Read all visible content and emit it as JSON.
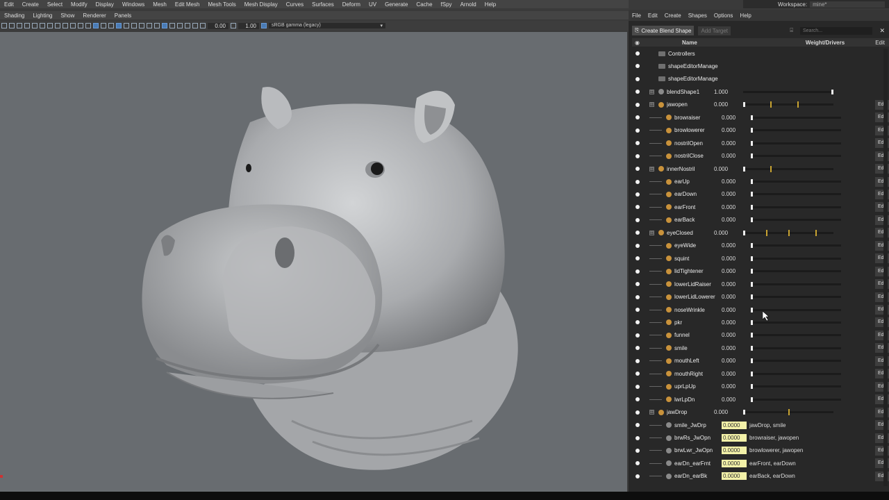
{
  "main_menu": [
    "Edit",
    "Create",
    "Select",
    "Modify",
    "Display",
    "Windows",
    "Mesh",
    "Edit Mesh",
    "Mesh Tools",
    "Mesh Display",
    "Curves",
    "Surfaces",
    "Deform",
    "UV",
    "Generate",
    "Cache",
    "fSpy",
    "Arnold",
    "Help"
  ],
  "workspace": {
    "label": "Workspace:",
    "value": "mine*"
  },
  "panel_menu": [
    "Shading",
    "Lighting",
    "Show",
    "Renderer",
    "Panels"
  ],
  "viewport_toolbar": {
    "value1": "0.00",
    "value2": "1.00",
    "color_space": "sRGB gamma (legacy)"
  },
  "shape_editor": {
    "menu": [
      "File",
      "Edit",
      "Create",
      "Shapes",
      "Options",
      "Help"
    ],
    "create_blend_shape": "Create Blend Shape",
    "add_target": "Add Target",
    "search_placeholder": "Search...",
    "col_name": "Name",
    "col_weight": "Weight/Drivers",
    "col_edit": "Edit",
    "rows": [
      {
        "name": "Controllers",
        "kind": "folder"
      },
      {
        "name": "shapeEditorManage",
        "kind": "folder"
      },
      {
        "name": "shapeEditorManage",
        "kind": "folder"
      },
      {
        "name": "blendShape1",
        "kind": "blend",
        "weight": "1.000",
        "knob": 1.0
      },
      {
        "name": "jawopen",
        "kind": "target",
        "weight": "0.000",
        "keys": [
          0.3,
          0.6
        ],
        "expand": true
      },
      {
        "name": "browraiser",
        "kind": "target",
        "weight": "0.000"
      },
      {
        "name": "browlowerer",
        "kind": "target",
        "weight": "0.000"
      },
      {
        "name": "nostrilOpen",
        "kind": "target",
        "weight": "0.000"
      },
      {
        "name": "nostrilClose",
        "kind": "target",
        "weight": "0.000"
      },
      {
        "name": "innerNostril",
        "kind": "target",
        "weight": "0.000",
        "keys": [
          0.3
        ],
        "expand": true
      },
      {
        "name": "earUp",
        "kind": "target",
        "weight": "0.000"
      },
      {
        "name": "earDown",
        "kind": "target",
        "weight": "0.000"
      },
      {
        "name": "earFront",
        "kind": "target",
        "weight": "0.000"
      },
      {
        "name": "earBack",
        "kind": "target",
        "weight": "0.000"
      },
      {
        "name": "eyeClosed",
        "kind": "target",
        "weight": "0.000",
        "keys": [
          0.25,
          0.5,
          0.8
        ],
        "expand": true
      },
      {
        "name": "eyeWide",
        "kind": "target",
        "weight": "0.000"
      },
      {
        "name": "squint",
        "kind": "target",
        "weight": "0.000"
      },
      {
        "name": "lidTightener",
        "kind": "target",
        "weight": "0.000"
      },
      {
        "name": "lowerLidRaiser",
        "kind": "target",
        "weight": "0.000"
      },
      {
        "name": "lowerLidLowerer",
        "kind": "target",
        "weight": "0.000"
      },
      {
        "name": "noseWrinkle",
        "kind": "target",
        "weight": "0.000"
      },
      {
        "name": "pkr",
        "kind": "target",
        "weight": "0.000"
      },
      {
        "name": "funnel",
        "kind": "target",
        "weight": "0.000"
      },
      {
        "name": "smile",
        "kind": "target",
        "weight": "0.000"
      },
      {
        "name": "mouthLeft",
        "kind": "target",
        "weight": "0.000"
      },
      {
        "name": "mouthRight",
        "kind": "target",
        "weight": "0.000"
      },
      {
        "name": "uprLpUp",
        "kind": "target",
        "weight": "0.000"
      },
      {
        "name": "lwrLpDn",
        "kind": "target",
        "weight": "0.000"
      },
      {
        "name": "jawDrop",
        "kind": "target",
        "weight": "0.000",
        "keys": [
          0.5
        ],
        "expand": true
      },
      {
        "name": "smile_JwDrp",
        "kind": "combo",
        "weight": "0.0000",
        "drivers": "jawDrop, smile"
      },
      {
        "name": "brwRs_JwOpn",
        "kind": "combo",
        "weight": "0.0000",
        "drivers": "browraiser, jawopen"
      },
      {
        "name": "brwLwr_JwOpn",
        "kind": "combo",
        "weight": "0.0000",
        "drivers": "browlowerer, jawopen"
      },
      {
        "name": "earDn_earFrnt",
        "kind": "combo",
        "weight": "0.0000",
        "drivers": "earFront, earDown"
      },
      {
        "name": "earDn_earBk",
        "kind": "combo",
        "weight": "0.0000",
        "drivers": "earBack, earDown"
      }
    ]
  }
}
